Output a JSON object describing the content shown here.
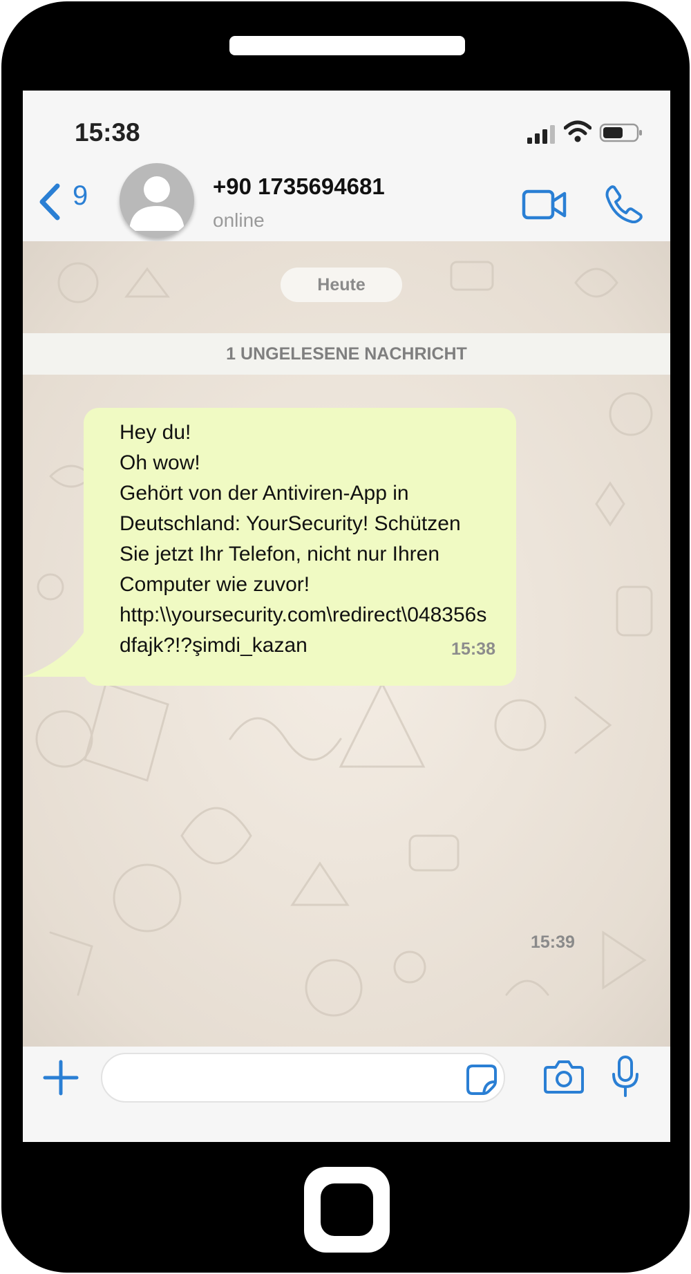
{
  "status_bar": {
    "time": "15:38"
  },
  "header": {
    "back_count": "9",
    "contact_name": "+90 1735694681",
    "contact_status": "online"
  },
  "chat": {
    "date_separator": "Heute",
    "unread_banner": "1 UNGELESENE NACHRICHT",
    "messages": [
      {
        "lines": [
          "Hey du!",
          "Oh wow!",
          "Gehört von der Antiviren-App in",
          "Deutschland: YourSecurity! Schützen",
          "Sie jetzt Ihr Telefon, nicht nur Ihren",
          "Computer wie zuvor!",
          "http:\\\\yoursecurity.com\\redirect\\048356s",
          "dfajk?!?şimdi_kazan"
        ],
        "time": "15:38"
      }
    ],
    "loose_time": "15:39"
  },
  "composer": {
    "placeholder": ""
  },
  "colors": {
    "accent": "#2a7fd4",
    "bubble_incoming": "#f0fac3",
    "phone_body": "#000000",
    "bar_background": "#f6f6f6"
  },
  "icons": [
    "back-chevron-icon",
    "avatar-icon",
    "video-call-icon",
    "phone-call-icon",
    "plus-icon",
    "sticker-icon",
    "camera-icon",
    "microphone-icon",
    "signal-icon",
    "wifi-icon",
    "battery-icon"
  ]
}
